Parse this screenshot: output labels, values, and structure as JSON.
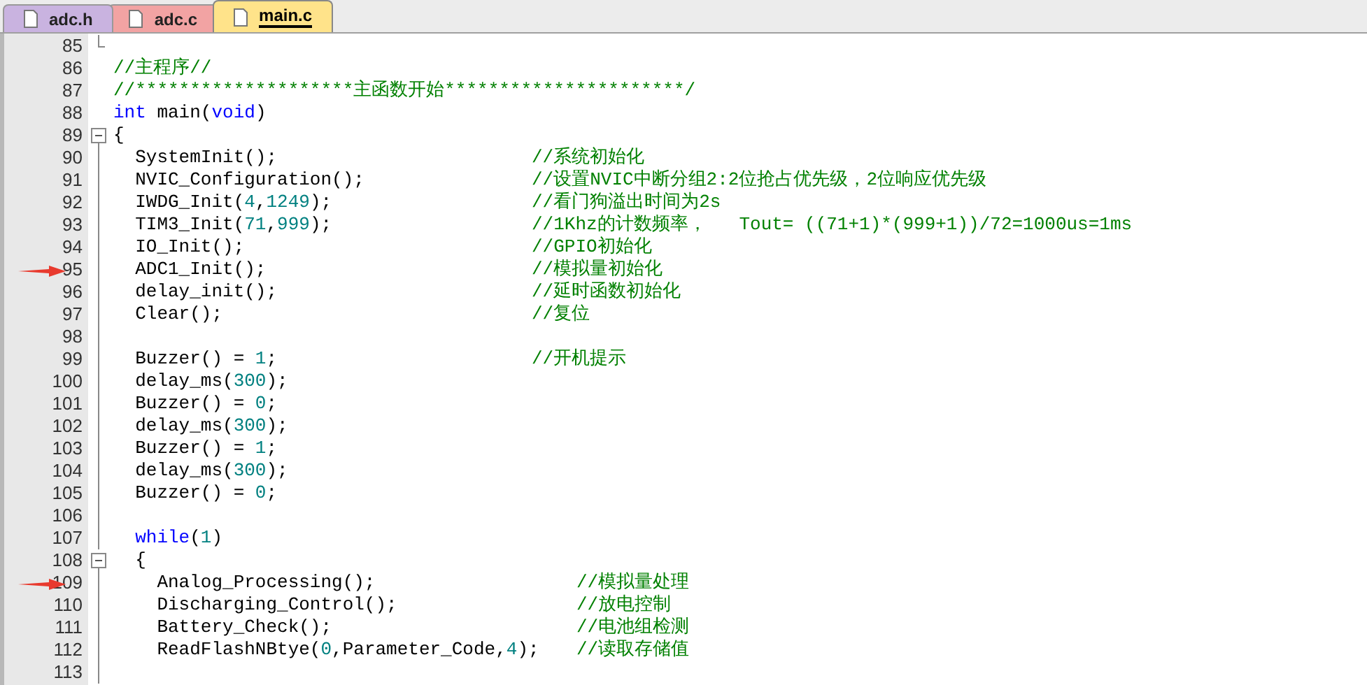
{
  "tabs": [
    {
      "label": "adc.h",
      "selected": false,
      "color": "#c9b3e0"
    },
    {
      "label": "adc.c",
      "selected": false,
      "color": "#f2a3a3"
    },
    {
      "label": "main.c",
      "selected": true,
      "color": "#ffe38a"
    }
  ],
  "lines": [
    {
      "number": "85",
      "fold_end": true
    },
    {
      "number": "86",
      "tokens": [
        {
          "kind": "comment",
          "text": "//主程序//"
        }
      ]
    },
    {
      "number": "87",
      "tokens": [
        {
          "kind": "comment",
          "text": "//********************主函数开始**********************/"
        }
      ]
    },
    {
      "number": "88",
      "tokens": [
        {
          "kind": "keyword",
          "text": "int"
        },
        {
          "kind": "plain",
          "text": " main("
        },
        {
          "kind": "keyword",
          "text": "void"
        },
        {
          "kind": "plain",
          "text": ")"
        }
      ]
    },
    {
      "number": "89",
      "fold_start": true,
      "tokens": [
        {
          "kind": "plain",
          "text": "{"
        }
      ]
    },
    {
      "number": "90",
      "tokens": [
        {
          "kind": "plain",
          "text": "  SystemInit();"
        },
        {
          "kind": "comment",
          "text": "//系统初始化"
        }
      ]
    },
    {
      "number": "91",
      "tokens": [
        {
          "kind": "plain",
          "text": "  NVIC_Configuration();"
        },
        {
          "kind": "comment",
          "text": "//设置NVIC中断分组2:2位抢占优先级，2位响应优先级"
        }
      ]
    },
    {
      "number": "92",
      "tokens": [
        {
          "kind": "plain",
          "text": "  IWDG_Init("
        },
        {
          "kind": "number",
          "text": "4"
        },
        {
          "kind": "plain",
          "text": ","
        },
        {
          "kind": "number",
          "text": "1249"
        },
        {
          "kind": "plain",
          "text": ");"
        },
        {
          "kind": "comment",
          "text": "//看门狗溢出时间为2s"
        }
      ]
    },
    {
      "number": "93",
      "tokens": [
        {
          "kind": "plain",
          "text": "  TIM3_Init("
        },
        {
          "kind": "number",
          "text": "71"
        },
        {
          "kind": "plain",
          "text": ","
        },
        {
          "kind": "number",
          "text": "999"
        },
        {
          "kind": "plain",
          "text": ");"
        },
        {
          "kind": "comment",
          "text": "//1Khz的计数频率，   Tout= ((71+1)*(999+1))/72=1000us=1ms"
        }
      ]
    },
    {
      "number": "94",
      "tokens": [
        {
          "kind": "plain",
          "text": "  IO_Init();"
        },
        {
          "kind": "comment",
          "text": "//GPIO初始化"
        }
      ]
    },
    {
      "number": "95",
      "arrow": true,
      "tokens": [
        {
          "kind": "plain",
          "text": "  ADC1_Init();"
        },
        {
          "kind": "comment",
          "text": "//模拟量初始化"
        }
      ]
    },
    {
      "number": "96",
      "tokens": [
        {
          "kind": "plain",
          "text": "  delay_init();"
        },
        {
          "kind": "comment",
          "text": "//延时函数初始化"
        }
      ]
    },
    {
      "number": "97",
      "tokens": [
        {
          "kind": "plain",
          "text": "  Clear();"
        },
        {
          "kind": "comment",
          "text": "//复位"
        }
      ]
    },
    {
      "number": "98"
    },
    {
      "number": "99",
      "tokens": [
        {
          "kind": "plain",
          "text": "  Buzzer() = "
        },
        {
          "kind": "number",
          "text": "1"
        },
        {
          "kind": "plain",
          "text": ";"
        },
        {
          "kind": "comment",
          "text": "//开机提示"
        }
      ]
    },
    {
      "number": "100",
      "tokens": [
        {
          "kind": "plain",
          "text": "  delay_ms("
        },
        {
          "kind": "number",
          "text": "300"
        },
        {
          "kind": "plain",
          "text": ");"
        }
      ]
    },
    {
      "number": "101",
      "tokens": [
        {
          "kind": "plain",
          "text": "  Buzzer() = "
        },
        {
          "kind": "number",
          "text": "0"
        },
        {
          "kind": "plain",
          "text": ";"
        }
      ]
    },
    {
      "number": "102",
      "tokens": [
        {
          "kind": "plain",
          "text": "  delay_ms("
        },
        {
          "kind": "number",
          "text": "300"
        },
        {
          "kind": "plain",
          "text": ");"
        }
      ]
    },
    {
      "number": "103",
      "tokens": [
        {
          "kind": "plain",
          "text": "  Buzzer() = "
        },
        {
          "kind": "number",
          "text": "1"
        },
        {
          "kind": "plain",
          "text": ";"
        }
      ]
    },
    {
      "number": "104",
      "tokens": [
        {
          "kind": "plain",
          "text": "  delay_ms("
        },
        {
          "kind": "number",
          "text": "300"
        },
        {
          "kind": "plain",
          "text": ");"
        }
      ]
    },
    {
      "number": "105",
      "tokens": [
        {
          "kind": "plain",
          "text": "  Buzzer() = "
        },
        {
          "kind": "number",
          "text": "0"
        },
        {
          "kind": "plain",
          "text": ";"
        }
      ]
    },
    {
      "number": "106"
    },
    {
      "number": "107",
      "tokens": [
        {
          "kind": "keyword",
          "text": "  while"
        },
        {
          "kind": "plain",
          "text": "("
        },
        {
          "kind": "number",
          "text": "1"
        },
        {
          "kind": "plain",
          "text": ")"
        }
      ]
    },
    {
      "number": "108",
      "fold_start": true,
      "tokens": [
        {
          "kind": "plain",
          "text": "  {"
        }
      ]
    },
    {
      "number": "109",
      "arrow": true,
      "tokens": [
        {
          "kind": "plain",
          "text": "    Analog_Processing();"
        },
        {
          "kind": "comment",
          "text": "//模拟量处理"
        }
      ]
    },
    {
      "number": "110",
      "tokens": [
        {
          "kind": "plain",
          "text": "    Discharging_Control();"
        },
        {
          "kind": "comment",
          "text": "//放电控制"
        }
      ]
    },
    {
      "number": "111",
      "tokens": [
        {
          "kind": "plain",
          "text": "    Battery_Check();"
        },
        {
          "kind": "comment",
          "text": "//电池组检测"
        }
      ]
    },
    {
      "number": "112",
      "tokens": [
        {
          "kind": "plain",
          "text": "    ReadFlashNBtye("
        },
        {
          "kind": "number",
          "text": "0"
        },
        {
          "kind": "plain",
          "text": ",Parameter_Code,"
        },
        {
          "kind": "number",
          "text": "4"
        },
        {
          "kind": "plain",
          "text": ");"
        },
        {
          "kind": "comment",
          "text": "//读取存储值"
        }
      ]
    },
    {
      "number": "113"
    }
  ]
}
